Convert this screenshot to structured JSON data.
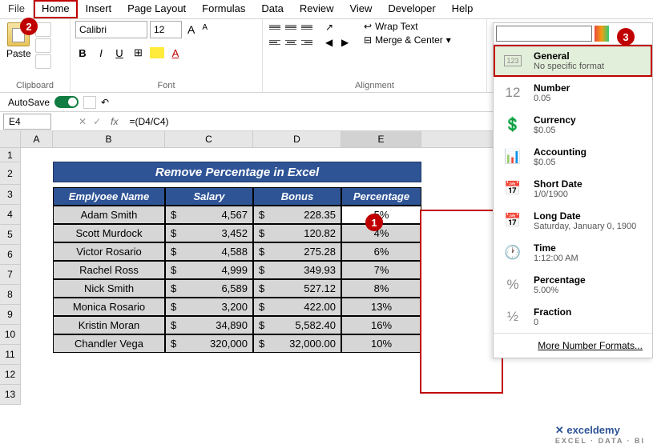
{
  "menu": {
    "file": "File",
    "home": "Home",
    "insert": "Insert",
    "page": "Page Layout",
    "formulas": "Formulas",
    "data": "Data",
    "review": "Review",
    "view": "View",
    "developer": "Developer",
    "help": "Help"
  },
  "ribbon": {
    "clipboard": {
      "paste": "Paste",
      "label": "Clipboard"
    },
    "font": {
      "name": "Calibri",
      "size": "12",
      "label": "Font",
      "bold": "B",
      "italic": "I",
      "underline": "U",
      "increase": "A",
      "decrease": "A"
    },
    "alignment": {
      "wrap": "Wrap Text",
      "merge": "Merge & Center",
      "label": "Alignment"
    }
  },
  "autosave": {
    "label": "AutoSave",
    "state": "On"
  },
  "formula": {
    "cell": "E4",
    "fx": "fx",
    "value": "=(D4/C4)"
  },
  "columns": [
    "A",
    "B",
    "C",
    "D",
    "E"
  ],
  "banner": "Remove Percentage in Excel",
  "headers": {
    "name": "Emplyoee Name",
    "salary": "Salary",
    "bonus": "Bonus",
    "pct": "Percentage"
  },
  "rows": [
    {
      "name": "Adam Smith",
      "salary": "4,567",
      "bonus": "228.35",
      "pct": "5%"
    },
    {
      "name": "Scott Murdock",
      "salary": "3,452",
      "bonus": "120.82",
      "pct": "4%"
    },
    {
      "name": "Victor Rosario",
      "salary": "4,588",
      "bonus": "275.28",
      "pct": "6%"
    },
    {
      "name": "Rachel Ross",
      "salary": "4,999",
      "bonus": "349.93",
      "pct": "7%"
    },
    {
      "name": "Nick Smith",
      "salary": "6,589",
      "bonus": "527.12",
      "pct": "8%"
    },
    {
      "name": "Monica Rosario",
      "salary": "3,200",
      "bonus": "422.00",
      "pct": "13%"
    },
    {
      "name": "Kristin Moran",
      "salary": "34,890",
      "bonus": "5,582.40",
      "pct": "16%"
    },
    {
      "name": "Chandler Vega",
      "salary": "320,000",
      "bonus": "32,000.00",
      "pct": "10%"
    }
  ],
  "currency": "$",
  "dropdown": {
    "items": [
      {
        "icon": "123",
        "title": "General",
        "sub": "No specific format"
      },
      {
        "icon": "12",
        "title": "Number",
        "sub": "0.05"
      },
      {
        "icon": "cur",
        "title": "Currency",
        "sub": "$0.05"
      },
      {
        "icon": "acc",
        "title": "Accounting",
        "sub": " $0.05"
      },
      {
        "icon": "sd",
        "title": "Short Date",
        "sub": "1/0/1900"
      },
      {
        "icon": "ld",
        "title": "Long Date",
        "sub": "Saturday, January 0, 1900"
      },
      {
        "icon": "tm",
        "title": "Time",
        "sub": "1:12:00 AM"
      },
      {
        "icon": "%",
        "title": "Percentage",
        "sub": "5.00%"
      },
      {
        "icon": "½",
        "title": "Fraction",
        "sub": "0"
      }
    ],
    "more": "More Number Formats..."
  },
  "badges": {
    "b1": "1",
    "b2": "2",
    "b3": "3"
  },
  "watermark": {
    "main": "✕ exceldemy",
    "sub": "EXCEL · DATA · BI"
  }
}
